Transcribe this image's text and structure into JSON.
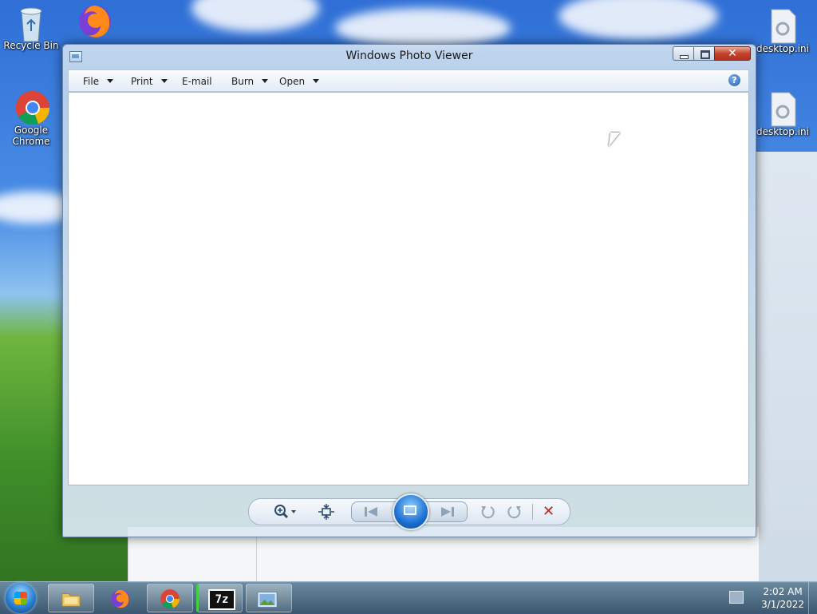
{
  "desktop": {
    "icons": [
      {
        "label": "Recycle Bin",
        "icon": "recycle-bin-icon"
      },
      {
        "label": "Google Chrome",
        "icon": "chrome-icon"
      },
      {
        "label": "desktop.ini",
        "icon": "ini-file-icon"
      },
      {
        "label": "desktop.ini",
        "icon": "ini-file-icon"
      }
    ]
  },
  "window": {
    "title": "Windows Photo Viewer",
    "menu": [
      {
        "label": "File",
        "has_dropdown": true
      },
      {
        "label": "Print",
        "has_dropdown": true
      },
      {
        "label": "E-mail",
        "has_dropdown": false
      },
      {
        "label": "Burn",
        "has_dropdown": true
      },
      {
        "label": "Open",
        "has_dropdown": true
      }
    ],
    "help_glyph": "?"
  },
  "taskbar": {
    "clock_time": "2:02 AM",
    "clock_date": "3/1/2022",
    "seven_zip_label": "7z"
  },
  "colors": {
    "close_button": "#c4432b",
    "delete_button": "#c41e1e",
    "accent": "#1c6fd1"
  }
}
